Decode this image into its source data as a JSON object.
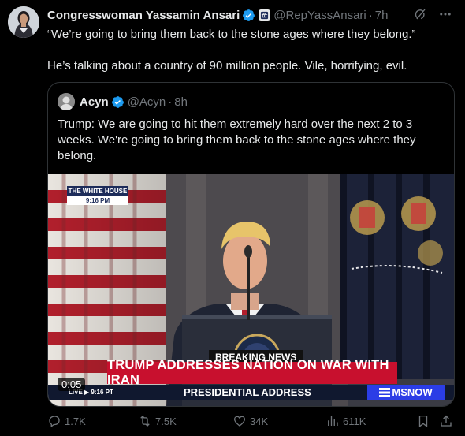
{
  "author": {
    "name": "Congresswoman Yassamin Ansari",
    "handle": "@RepYassAnsari",
    "separator": "·",
    "time": "7h"
  },
  "post": {
    "line1": "“We’re going to bring them back to the stone ages where they belong.”",
    "line2": "He’s talking about a country of 90 million people. Vile, horrifying, evil."
  },
  "quote": {
    "name": "Acyn",
    "handle": "@Acyn",
    "separator": "·",
    "time": "8h",
    "text": "Trump: We are going to hit them extremely hard over the next 2 to 3 weeks. We're going to bring them back to the stone ages where they belong."
  },
  "video": {
    "location_tag": "THE WHITE HOUSE",
    "location_time": "9:16 PM",
    "breaking_label": "BREAKING NEWS",
    "headline": "TRUMP ADDRESSES NATION ON WAR WITH IRAN",
    "live_label": "LIVE",
    "live_time": "9:16",
    "live_zone": "PT",
    "subheadline": "PRESIDENTIAL ADDRESS",
    "network": "MSNOW",
    "timestamp": "0:05"
  },
  "metrics": {
    "replies": "1.7K",
    "reposts": "7.5K",
    "likes": "34K",
    "views": "611K"
  },
  "colors": {
    "background": "#000000",
    "text": "#e7e9ea",
    "muted": "#71767b",
    "verified": "#1d9bf0",
    "headline_red": "#c8102e",
    "network_blue": "#2b3de6"
  },
  "icons": {
    "verified": "verified-badge-icon",
    "government": "government-label-icon",
    "grok": "grok-icon",
    "more": "more-icon",
    "reply": "reply-icon",
    "repost": "repost-icon",
    "like": "heart-icon",
    "views": "views-icon",
    "bookmark": "bookmark-icon",
    "share": "share-icon"
  }
}
